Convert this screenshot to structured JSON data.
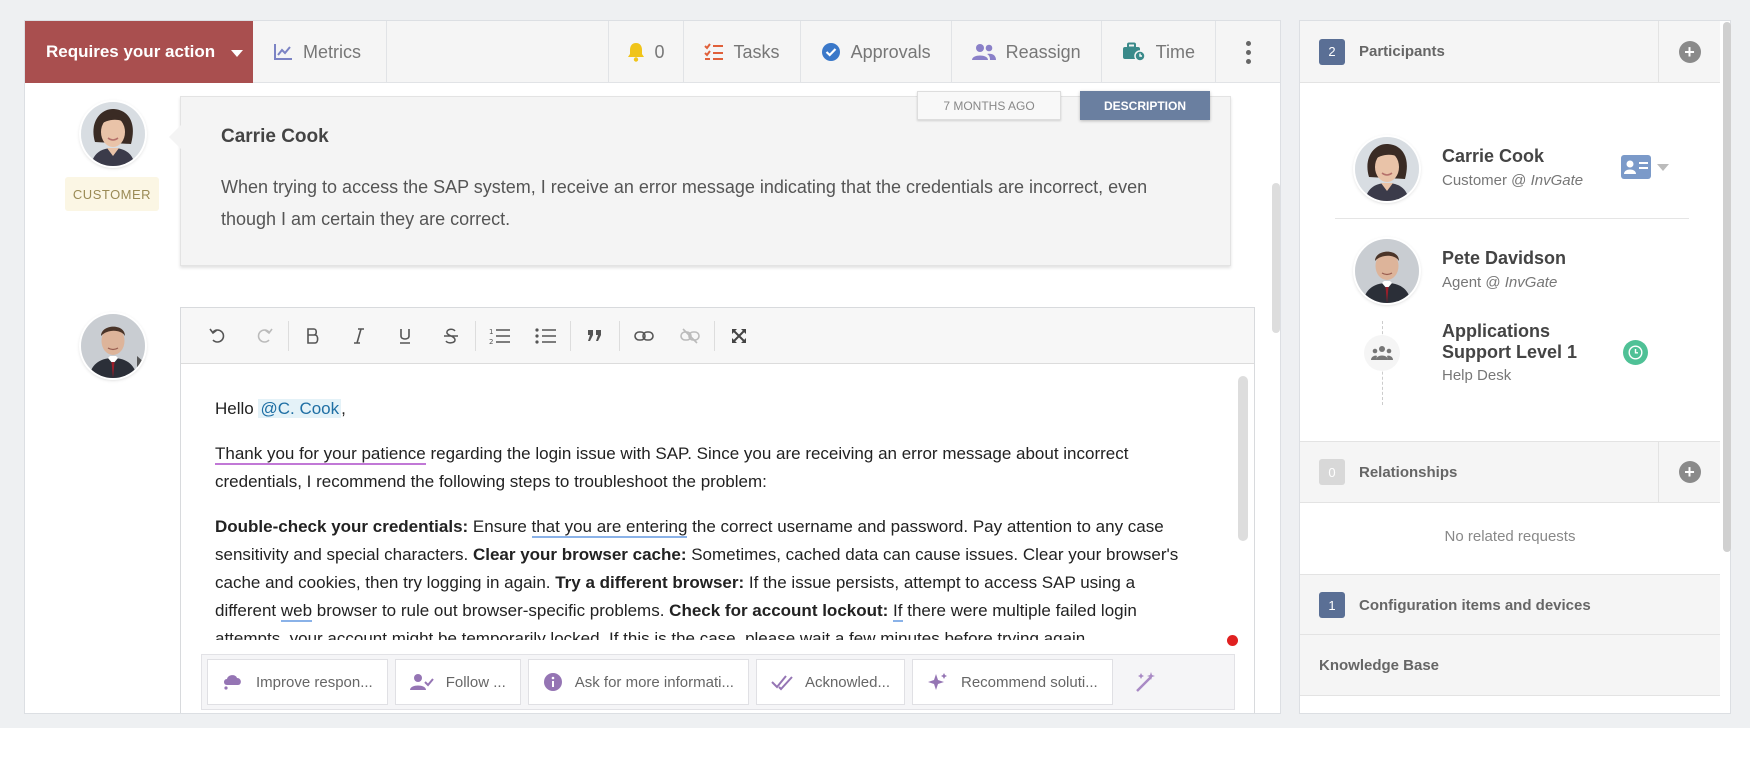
{
  "topbar": {
    "action_label": "Requires your action",
    "metrics_label": "Metrics",
    "notifications_count": "0",
    "tasks_label": "Tasks",
    "approvals_label": "Approvals",
    "reassign_label": "Reassign",
    "time_label": "Time"
  },
  "description_message": {
    "author": "Carrie Cook",
    "role_badge": "CUSTOMER",
    "time_tag": "7 MONTHS AGO",
    "type_tag": "DESCRIPTION",
    "text": "When trying to access the SAP system, I receive an error message indicating that the credentials are incorrect, even though I am certain they are correct."
  },
  "editor": {
    "greeting_prefix": "Hello ",
    "mention": "@C. Cook",
    "greeting_suffix": ",",
    "p2_underlined": "Thank you for your patience",
    "p2_rest": " regarding the login issue with SAP. Since you are receiving an error message about incorrect credentials, I recommend the following steps to troubleshoot the problem:",
    "p3_b1": "Double-check your credentials:",
    "p3_t1a": " Ensure ",
    "p3_t1u": "that you are entering",
    "p3_t1b": " the correct username and password. Pay attention to any case sensitivity and special characters. ",
    "p3_b2": "Clear your browser cache:",
    "p3_t2": " Sometimes, cached data can cause issues. Clear your browser's cache and cookies, then try logging in again. ",
    "p3_b3": "Try a different browser:",
    "p3_t3a": " If the issue persists, attempt to access SAP using a different ",
    "p3_t3u": "web",
    "p3_t3b": " browser to rule out browser-specific problems. ",
    "p3_b4": "Check for account lockout:",
    "p3_t4a": " ",
    "p3_t4u": "If",
    "p3_t4b": " there were multiple failed login attempts, your account might be temporarily locked. If this is the case, please wait a few minutes before trying again."
  },
  "suggestions": [
    {
      "label": "Improve respon...",
      "icon": "cloud-sparkle-icon"
    },
    {
      "label": "Follow ...",
      "icon": "user-check-icon"
    },
    {
      "label": "Ask for more informati...",
      "icon": "info-icon"
    },
    {
      "label": "Acknowled...",
      "icon": "double-check-icon"
    },
    {
      "label": "Recommend soluti...",
      "icon": "sparkles-icon"
    }
  ],
  "participants": {
    "count": "2",
    "title": "Participants",
    "people": [
      {
        "name": "Carrie Cook",
        "role": "Customer @ ",
        "org": "InvGate"
      },
      {
        "name": "Pete Davidson",
        "role": "Agent @ ",
        "org": "InvGate"
      }
    ],
    "group": {
      "name": "Applications Support Level 1",
      "type": "Help Desk"
    }
  },
  "relationships": {
    "count": "0",
    "title": "Relationships",
    "empty_text": "No related requests"
  },
  "config_items": {
    "count": "1",
    "title": "Configuration items and devices"
  },
  "knowledge_base": {
    "title": "Knowledge Base"
  },
  "colors": {
    "action_red": "#a94f4f",
    "badge_blue": "#5a6f95",
    "description_tag": "#6a7fa0",
    "mention_blue": "#1f6fa4",
    "ai_purple": "#9575b4",
    "status_green": "#4fc196"
  }
}
